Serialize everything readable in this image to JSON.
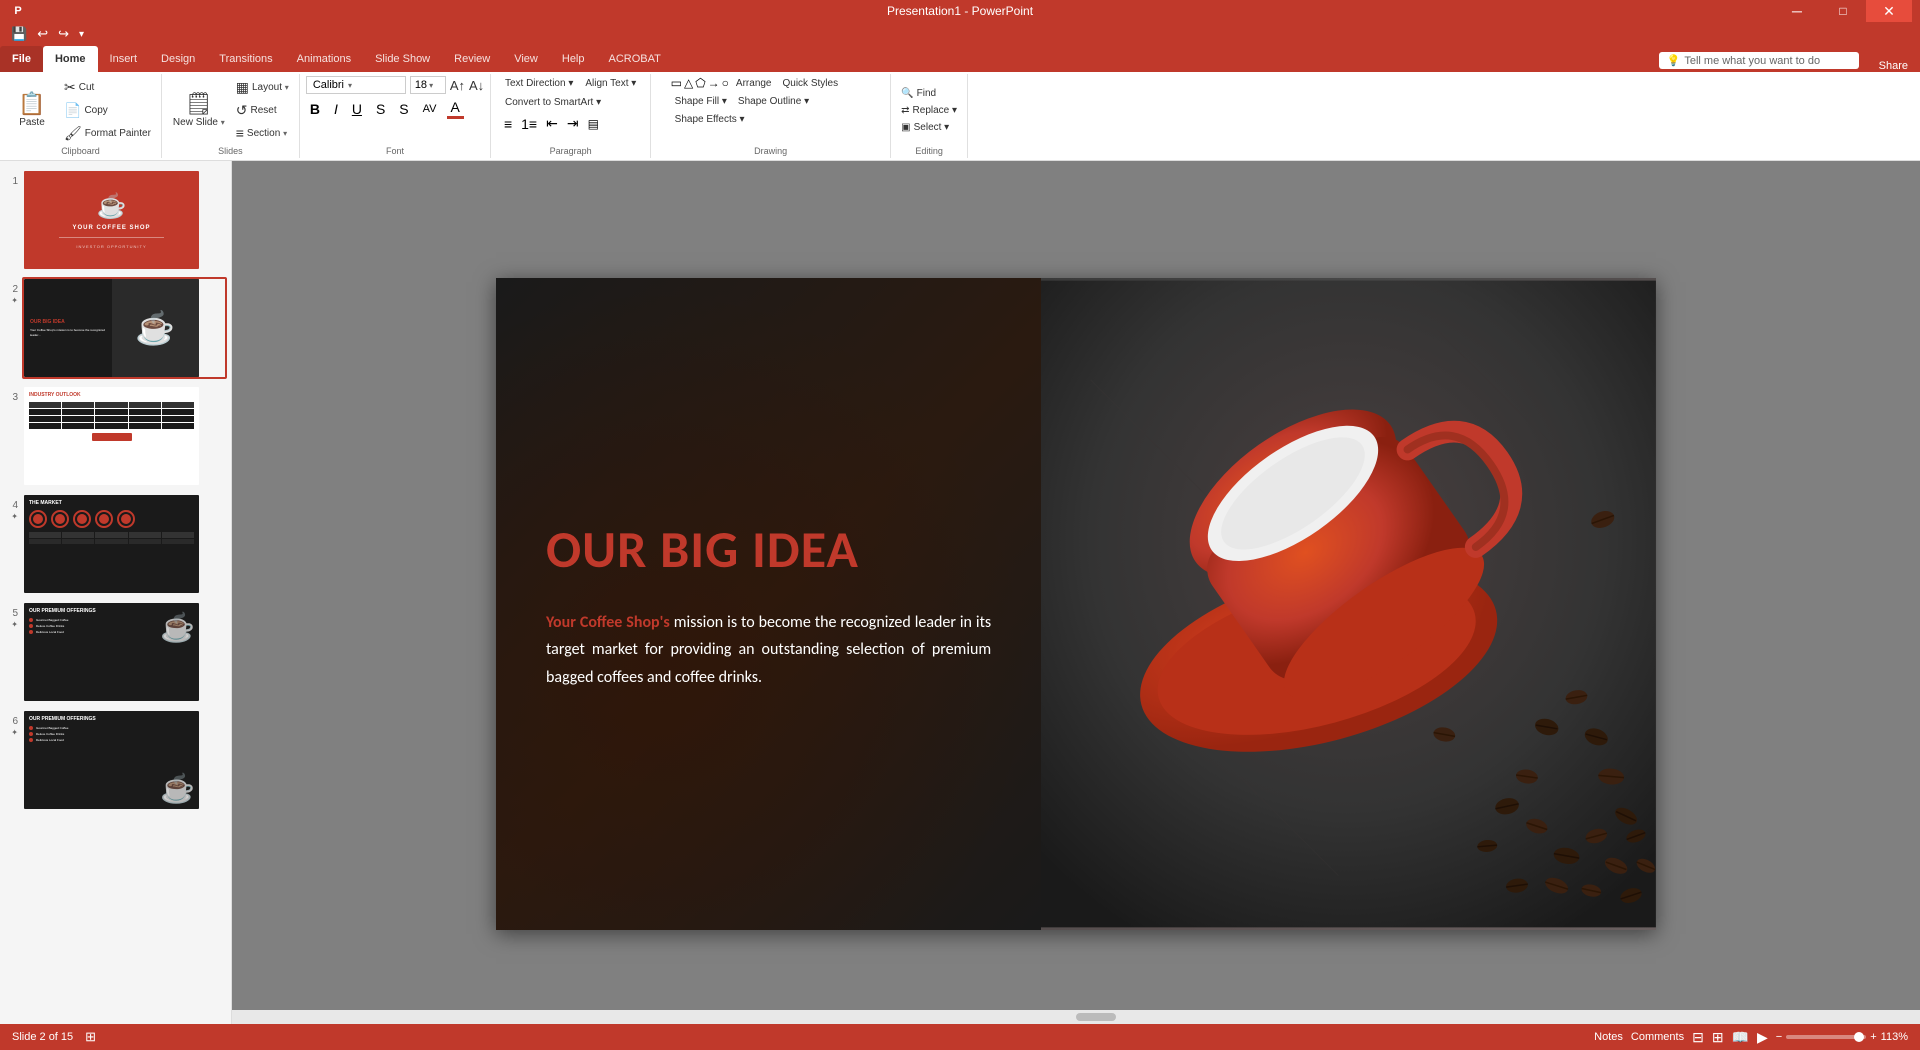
{
  "titleBar": {
    "title": "Presentation1 - PowerPoint",
    "controls": [
      "minimize",
      "maximize",
      "close"
    ]
  },
  "qat": {
    "buttons": [
      "save",
      "undo",
      "redo",
      "customize"
    ]
  },
  "ribbon": {
    "tabs": [
      "File",
      "Home",
      "Insert",
      "Design",
      "Transitions",
      "Animations",
      "Slide Show",
      "Review",
      "View",
      "Help",
      "ACROBAT"
    ],
    "activeTab": "Home",
    "groups": {
      "clipboard": {
        "label": "Clipboard",
        "buttons": [
          "Paste",
          "Cut",
          "Copy",
          "Format Painter"
        ]
      },
      "slides": {
        "label": "Slides",
        "buttons": [
          "New Slide",
          "Layout",
          "Reset",
          "Section"
        ]
      },
      "font": {
        "label": "Font"
      },
      "paragraph": {
        "label": "Paragraph"
      },
      "drawing": {
        "label": "Drawing"
      },
      "editing": {
        "label": "Editing",
        "buttons": [
          "Find",
          "Replace",
          "Select"
        ]
      }
    }
  },
  "tellMe": {
    "placeholder": "Tell me what you want to do"
  },
  "slidesPanel": {
    "slides": [
      {
        "num": "1",
        "type": "title"
      },
      {
        "num": "2",
        "type": "bigidea",
        "active": true
      },
      {
        "num": "3",
        "type": "industry"
      },
      {
        "num": "4",
        "type": "market"
      },
      {
        "num": "5",
        "type": "offerings1"
      },
      {
        "num": "6",
        "type": "offerings2"
      }
    ]
  },
  "currentSlide": {
    "title": "OUR BIG IDEA",
    "accentText": "Your Coffee Shop's",
    "bodyText": " mission is to become the recognized leader in its target market for providing an outstanding selection of premium bagged coffees and coffee drinks."
  },
  "statusBar": {
    "slideInfo": "Slide 2 of 15",
    "notes": "Notes",
    "comments": "Comments",
    "zoom": "113%"
  }
}
